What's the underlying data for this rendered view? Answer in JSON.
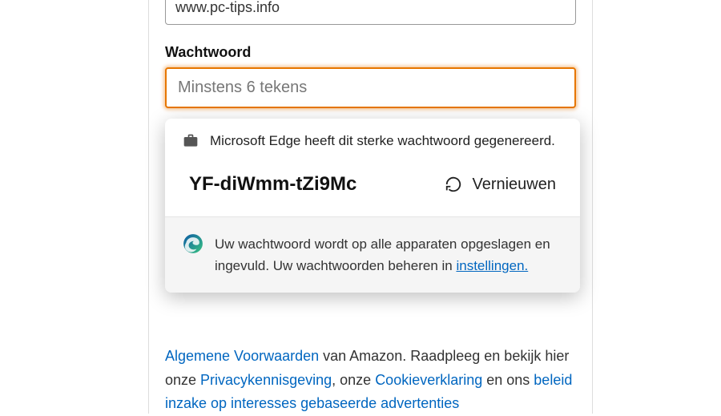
{
  "url_field": {
    "value": "www.pc-tips.info"
  },
  "password_field": {
    "label": "Wachtwoord",
    "placeholder": "Minstens 6 tekens"
  },
  "popup": {
    "header_text": "Microsoft Edge heeft dit sterke wachtwoord gegenereerd.",
    "generated_password": "YF-diWmm-tZi9Mc",
    "refresh_label": "Vernieuwen",
    "footer_text_1": "Uw wachtwoord wordt op alle apparaten opgeslagen en ingevuld. Uw wachtwoorden beheren in ",
    "settings_link": "instellingen."
  },
  "terms": {
    "link_terms": "Algemene Voorwaarden",
    "text_1": " van Amazon. Raadpleeg en bekijk hier onze ",
    "link_privacy": "Privacykennisgeving",
    "text_2": ", onze ",
    "link_cookie": "Cookieverklaring",
    "text_3": " en ons ",
    "link_interest": "beleid inzake op interesses gebaseerde advertenties"
  }
}
